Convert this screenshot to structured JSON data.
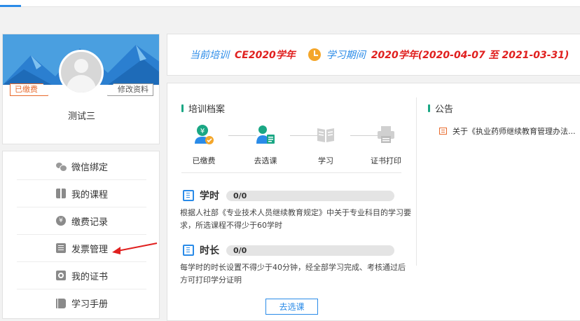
{
  "profile": {
    "paid_tag": "已缴费",
    "edit_tag": "修改资料",
    "username": "测试三"
  },
  "menu": {
    "items": [
      {
        "label": "微信绑定",
        "icon": "wechat-icon"
      },
      {
        "label": "我的课程",
        "icon": "book-icon"
      },
      {
        "label": "缴费记录",
        "icon": "yen-icon"
      },
      {
        "label": "发票管理",
        "icon": "invoice-icon"
      },
      {
        "label": "我的证书",
        "icon": "certificate-icon"
      },
      {
        "label": "学习手册",
        "icon": "manual-icon"
      }
    ],
    "annotation_arrow_color": "#e0201f"
  },
  "training": {
    "current_label": "当前培训",
    "current_value": "CE2020学年",
    "period_label": "学习期间",
    "period_value": "2020学年(2020-04-07 至 2021-03-31)"
  },
  "archive": {
    "title": "培训档案",
    "steps": [
      {
        "label": "已缴费",
        "icon": "paid-icon",
        "active": true
      },
      {
        "label": "去选课",
        "icon": "select-course-icon",
        "active": true
      },
      {
        "label": "学习",
        "icon": "study-icon",
        "active": false
      },
      {
        "label": "证书打印",
        "icon": "print-icon",
        "active": false
      }
    ],
    "hours": {
      "name": "学时",
      "value": "0/0",
      "progress": 0,
      "desc": "根据人社部《专业技术人员继续教育规定》中关于专业科目的学习要求，所选课程不得少于60学时"
    },
    "duration": {
      "name": "时长",
      "value": "0/0",
      "progress": 0,
      "desc": "每学时的时长设置不得少于40分钟，经全部学习完成、考核通过后方可打印学分证明"
    },
    "button": "去选课"
  },
  "announcement": {
    "title": "公告",
    "items": [
      {
        "text": "关于《执业药师继续教育管理办法..."
      }
    ]
  },
  "colors": {
    "accent": "#2a8be8",
    "red": "#e0201f",
    "orange": "#e8692b",
    "green": "#1aa784"
  }
}
